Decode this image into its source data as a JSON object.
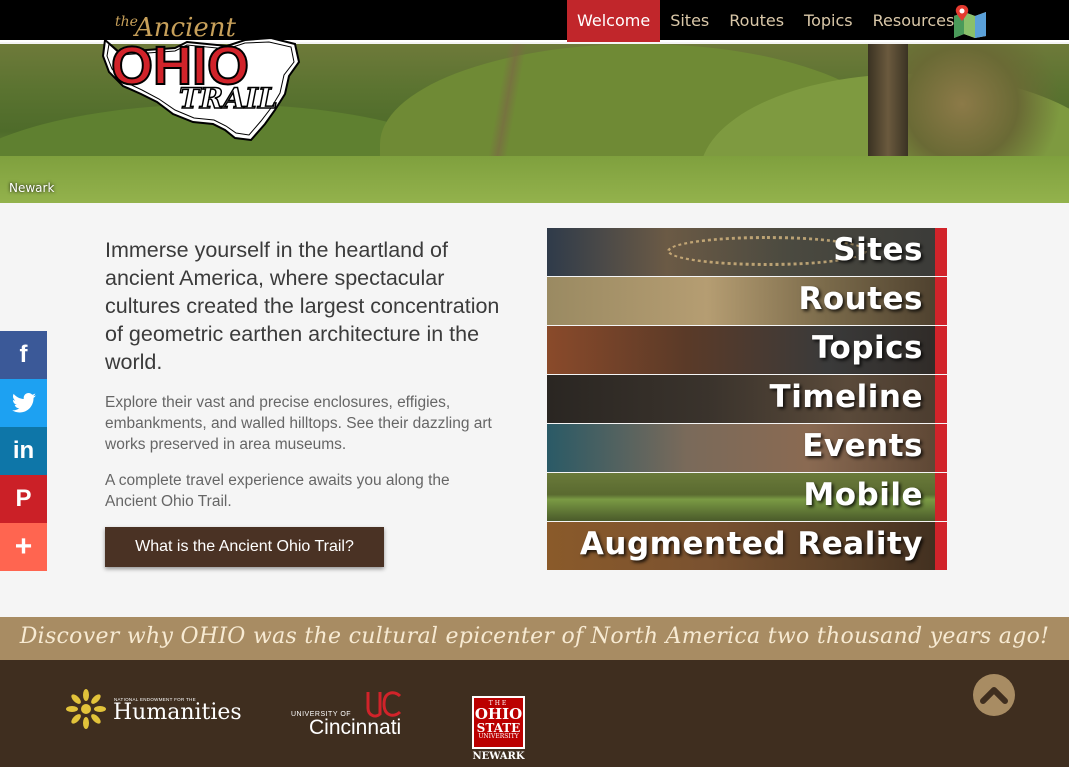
{
  "nav": {
    "items": [
      {
        "label": "Welcome",
        "active": true
      },
      {
        "label": "Sites"
      },
      {
        "label": "Routes"
      },
      {
        "label": "Topics"
      },
      {
        "label": "Resources"
      }
    ],
    "map_icon": "map-pin-icon"
  },
  "logo": {
    "line1": "the Ancient",
    "line2": "OHIO",
    "line3": "TRAIL"
  },
  "hero": {
    "caption": "Newark"
  },
  "intro": {
    "lead": "Immerse yourself in the heartland of ancient America, where spectacular cultures created the largest concentration of geometric earthen architecture in the world.",
    "p1": "Explore their vast and precise enclosures, effigies, embankments, and walled hilltops. See their dazzling art works preserved in area museums.",
    "p2": "A complete travel experience awaits you along the Ancient Ohio Trail.",
    "cta": "What is the Ancient Ohio Trail?"
  },
  "social": [
    {
      "icon": "facebook-icon",
      "glyph": "f",
      "color": "#3b5998"
    },
    {
      "icon": "twitter-icon",
      "glyph": "t",
      "color": "#1da1f2"
    },
    {
      "icon": "linkedin-icon",
      "glyph": "in",
      "color": "#0e76a8"
    },
    {
      "icon": "pinterest-icon",
      "glyph": "P",
      "color": "#cb2027"
    },
    {
      "icon": "more-icon",
      "glyph": "+",
      "color": "#ff6550"
    }
  ],
  "tiles": [
    {
      "label": "Sites"
    },
    {
      "label": "Routes"
    },
    {
      "label": "Topics"
    },
    {
      "label": "Timeline"
    },
    {
      "label": "Events"
    },
    {
      "label": "Mobile"
    },
    {
      "label": "Augmented Reality"
    }
  ],
  "tagline": "Discover why OHIO was the cultural epicenter of North America two thousand years ago!",
  "footer": {
    "neh_small": "NATIONAL ENDOWMENT FOR THE",
    "neh_big": "Humanities",
    "uc_small": "UNIVERSITY OF",
    "uc_big": "Cincinnati",
    "osu_top": "THE",
    "osu_mid1": "OHIO",
    "osu_mid2": "STATE",
    "osu_uni": "UNIVERSITY",
    "osu_bottom": "NEWARK"
  },
  "colors": {
    "accent": "#c1262b",
    "brown": "#4a3224",
    "tan": "#a88c63",
    "footer": "#3f2e1f"
  }
}
